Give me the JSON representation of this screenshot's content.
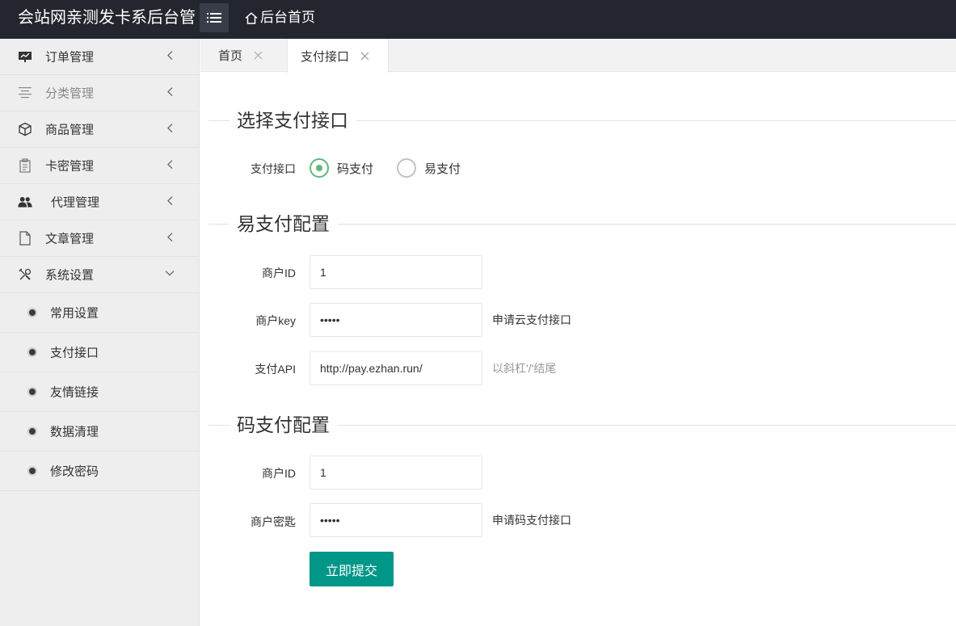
{
  "header": {
    "brand": "会站网亲测发卡系后台管",
    "home_link": "后台首页"
  },
  "sidebar": {
    "items": [
      {
        "label": "订单管理",
        "icon": "chart-board-icon"
      },
      {
        "label": "分类管理",
        "icon": "align-center-icon"
      },
      {
        "label": "商品管理",
        "icon": "cube-icon"
      },
      {
        "label": "卡密管理",
        "icon": "clipboard-icon"
      },
      {
        "label": "代理管理",
        "icon": "users-icon"
      },
      {
        "label": "文章管理",
        "icon": "document-icon"
      },
      {
        "label": "系统设置",
        "icon": "tools-icon"
      }
    ],
    "sub_items": [
      {
        "label": "常用设置"
      },
      {
        "label": "支付接口"
      },
      {
        "label": "友情链接"
      },
      {
        "label": "数据清理"
      },
      {
        "label": "修改密码"
      }
    ]
  },
  "tabs": [
    {
      "label": "首页"
    },
    {
      "label": "支付接口"
    }
  ],
  "sections": {
    "select": {
      "title": "选择支付接口",
      "field_label": "支付接口",
      "options": [
        {
          "label": "码支付",
          "checked": true
        },
        {
          "label": "易支付",
          "checked": false
        }
      ]
    },
    "epay": {
      "title": "易支付配置",
      "merchant_id_label": "商户ID",
      "merchant_id_value": "1",
      "merchant_key_label": "商户key",
      "merchant_key_value": "12345",
      "merchant_key_hint": "申请云支付接口",
      "api_label": "支付API",
      "api_value": "http://pay.ezhan.run/",
      "api_hint": "以斜杠'/'结尾"
    },
    "codepay": {
      "title": "码支付配置",
      "merchant_id_label": "商户ID",
      "merchant_id_value": "1",
      "merchant_secret_label": "商户密匙",
      "merchant_secret_value": "12345",
      "merchant_secret_hint": "申请码支付接口"
    }
  },
  "submit_label": "立即提交",
  "colors": {
    "header_bg": "#23262e",
    "sidebar_bg": "#eeeeee",
    "accent": "#009688",
    "radio_checked": "#5fb878"
  }
}
